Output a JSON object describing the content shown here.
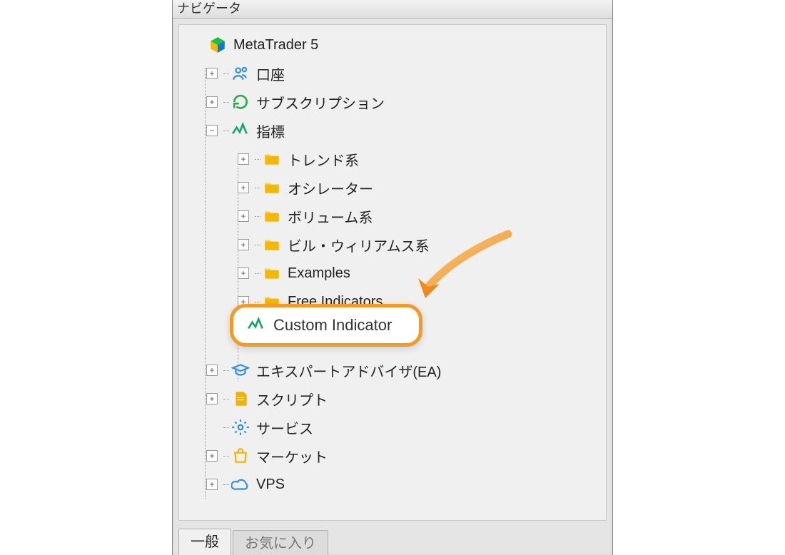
{
  "panel": {
    "title": "ナビゲータ"
  },
  "root": {
    "label": "MetaTrader 5"
  },
  "level1": {
    "accounts": "口座",
    "subscription": "サブスクリプション",
    "indicators": "指標",
    "experts": "エキスパートアドバイザ(EA)",
    "scripts": "スクリプト",
    "services": "サービス",
    "market": "マーケット",
    "vps": "VPS"
  },
  "indicator_children": {
    "trend": "トレンド系",
    "oscillator": "オシレーター",
    "volume": "ボリューム系",
    "bill_williams": "ビル・ウィリアムス系",
    "examples": "Examples",
    "free": "Free Indicators",
    "custom": "Custom Indicator"
  },
  "tabs": {
    "general": "一般",
    "favorites": "お気に入り"
  }
}
